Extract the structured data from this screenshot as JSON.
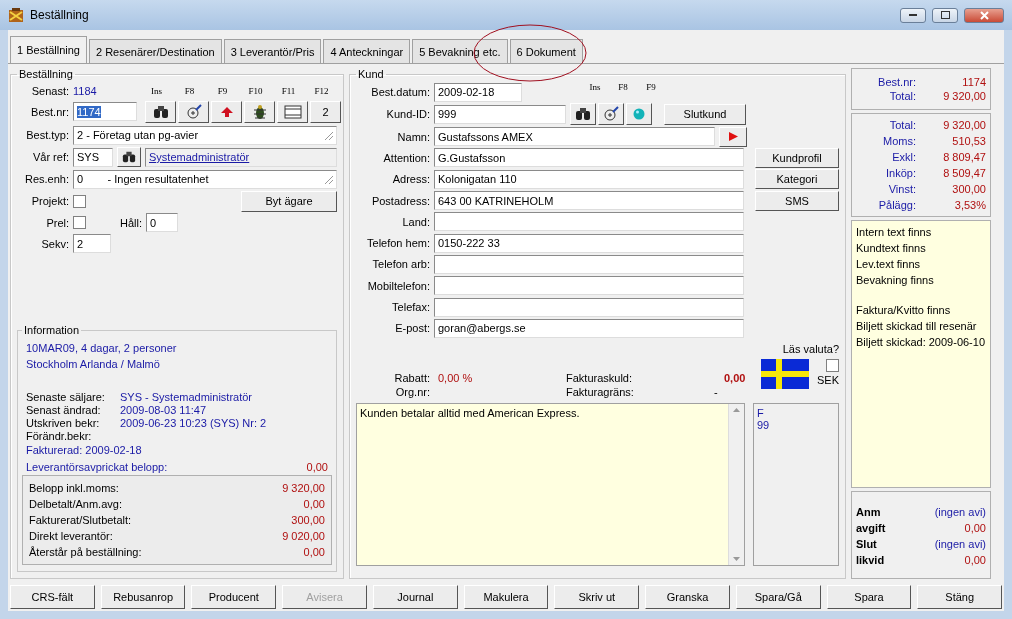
{
  "window": {
    "title": "Beställning"
  },
  "tabs": [
    {
      "label": "1 Beställning",
      "selected": true
    },
    {
      "label": "2 Resenärer/Destination",
      "selected": false
    },
    {
      "label": "3 Leverantör/Pris",
      "selected": false
    },
    {
      "label": "4 Anteckningar",
      "selected": false
    },
    {
      "label": "5 Bevakning etc.",
      "selected": false
    },
    {
      "label": "6 Dokument",
      "selected": false
    }
  ],
  "order": {
    "title": "Beställning",
    "latest_label": "Senast:",
    "latest": "1184",
    "fkeys": [
      "Ins",
      "F8",
      "F9",
      "F10",
      "F11",
      "F12"
    ],
    "order_no": {
      "label": "Best.nr:",
      "value": "1174"
    },
    "tools": [
      {
        "kind": "binoculars"
      },
      {
        "kind": "zoom"
      },
      {
        "kind": "arrow"
      },
      {
        "kind": "bug"
      },
      {
        "kind": "film"
      },
      {
        "kind": "text",
        "label": "2"
      }
    ],
    "order_type": {
      "label": "Best.typ:",
      "value": "2  - Företag utan pg-avier"
    },
    "our_ref": {
      "label": "Vår ref:",
      "code": "SYS",
      "name": "Systemadministratör"
    },
    "result_unit": {
      "label": "Res.enh:",
      "value": "0        - Ingen resultatenhet"
    },
    "project": {
      "label": "Projekt:",
      "checked": false
    },
    "change_owner": "Byt ägare",
    "prel": {
      "label": "Prel:",
      "checked": false
    },
    "hold": {
      "label": "Håll:",
      "value": "0"
    },
    "sequence": {
      "label": "Sekv:",
      "value": "2"
    }
  },
  "information": {
    "title": "Information",
    "lines": [
      {
        "kind": "trip",
        "text": "10MAR09, 4 dagar, 2 personer"
      },
      {
        "kind": "trip",
        "text": "Stockholm Arlanda / Malmö"
      },
      {
        "kind": "gap"
      },
      {
        "kind": "field",
        "label": "Senaste säljare:",
        "value": "SYS - Systemadministratör"
      },
      {
        "kind": "field",
        "label": "Senast ändrad:",
        "value": "2009-08-03 11:47"
      },
      {
        "kind": "field",
        "label": "Utskriven bekr:",
        "value": "2009-06-23 10:23 (SYS) Nr: 2"
      },
      {
        "kind": "field",
        "label": "Förändr.bekr:"
      },
      {
        "kind": "trip",
        "text": "Fakturerad: 2009-02-18"
      },
      {
        "kind": "settled",
        "label": "Leverantörsavprickat belopp:",
        "value": "0,00"
      }
    ],
    "amounts": [
      {
        "label": "Belopp inkl.moms:",
        "value": "9 320,00"
      },
      {
        "label": "Delbetalt/Anm.avg:",
        "value": "0,00"
      },
      {
        "label": "Fakturerat/Slutbetalt:",
        "value": "300,00"
      },
      {
        "label": "Direkt leverantör:",
        "value": "9 020,00"
      },
      {
        "label": "Återstår på beställning:",
        "value": "0,00"
      }
    ]
  },
  "customer": {
    "title": "Kund",
    "date": {
      "label": "Best.datum:",
      "value": "2009-02-18"
    },
    "fkeys": [
      "Ins",
      "F8",
      "F9"
    ],
    "id": {
      "label": "Kund-ID:",
      "value": "999"
    },
    "tools": [
      {
        "kind": "binoculars"
      },
      {
        "kind": "zoom"
      },
      {
        "kind": "ball"
      }
    ],
    "end_customer": "Slutkund",
    "fields": [
      {
        "label": "Namn:",
        "value": "Gustafssons AMEX",
        "kind": "name"
      },
      {
        "label": "Attention:",
        "value": "G.Gustafsson",
        "kind": "plain"
      },
      {
        "label": "Adress:",
        "value": "Kolonigatan 110",
        "kind": "plain"
      },
      {
        "label": "Postadress:",
        "value": "643 00  KATRINEHOLM",
        "kind": "plain"
      },
      {
        "label": "Land:",
        "kind": "plain"
      },
      {
        "label": "Telefon hem:",
        "value": "0150-222 33",
        "kind": "plain"
      },
      {
        "label": "Telefon arb:",
        "kind": "plain"
      },
      {
        "label": "Mobiltelefon:",
        "kind": "plain"
      },
      {
        "label": "Telefax:",
        "kind": "plain"
      },
      {
        "label": "E-post:",
        "value": "goran@abergs.se",
        "kind": "plain"
      }
    ],
    "side_buttons": [
      "Kundprofil",
      "Kategori",
      "SMS"
    ],
    "lock_currency": {
      "label": "Läs valuta?",
      "checked": false
    },
    "currency": "SEK",
    "discount": {
      "label": "Rabatt:",
      "value": "0,00 %"
    },
    "debt": {
      "label": "Fakturaskuld:",
      "value": "0,00"
    },
    "org_no": {
      "label": "Org.nr:"
    },
    "limit": {
      "label": "Fakturagräns:",
      "value": "-"
    },
    "note": "Kunden betalar alltid med American Express.",
    "side_box": [
      "F",
      "99"
    ]
  },
  "summary": {
    "order_no": {
      "label": "Best.nr:",
      "value": "1174"
    },
    "total": {
      "label": "Total:",
      "value": "9 320,00"
    },
    "figures": [
      {
        "label": "Total:",
        "value": "9 320,00"
      },
      {
        "label": "Moms:",
        "value": "510,53"
      },
      {
        "label": "Exkl:",
        "value": "8 809,47"
      },
      {
        "label": "Inköp:",
        "value": "8 509,47"
      },
      {
        "label": "Vinst:",
        "value": "300,00"
      },
      {
        "label": "Pålägg:",
        "value": "3,53%"
      }
    ],
    "flags": [
      "Intern text finns",
      "Kundtext finns",
      "Lev.text finns",
      "Bevakning finns"
    ],
    "flags2": [
      "Faktura/Kvitto finns",
      "Biljett skickad till resenär",
      "Biljett skickad: 2009-06-10"
    ],
    "notices": [
      {
        "label": "Anm",
        "value": "(ingen avi)",
        "kind": "avi"
      },
      {
        "label": "avgift",
        "value": "0,00",
        "kind": "amount"
      },
      {
        "label": "Slut",
        "value": "(ingen avi)",
        "kind": "avi"
      },
      {
        "label": "likvid",
        "value": "0,00",
        "kind": "amount"
      }
    ]
  },
  "buttons": [
    {
      "label": "CRS-fält",
      "disabled": false
    },
    {
      "label": "Rebusanrop",
      "disabled": false
    },
    {
      "label": "Producent",
      "disabled": false
    },
    {
      "label": "Avisera",
      "disabled": true
    },
    {
      "label": "Journal",
      "disabled": false
    },
    {
      "label": "Makulera",
      "disabled": false
    },
    {
      "label": "Skriv ut",
      "disabled": false
    },
    {
      "label": "Granska",
      "disabled": false
    },
    {
      "label": "Spara/Gå",
      "disabled": false
    },
    {
      "label": "Spara",
      "disabled": false
    },
    {
      "label": "Stäng",
      "disabled": false
    }
  ]
}
